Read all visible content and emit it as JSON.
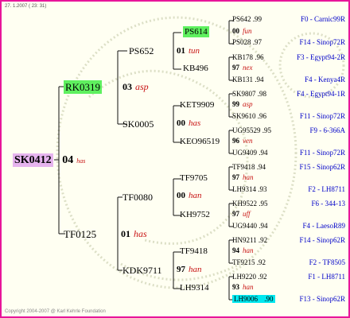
{
  "header": "27. 1.2007 ( 23: 31)",
  "footer": "Copyright 2004-2007 @ Karl Kehrle Foundation",
  "colors": {
    "frame": "#e8159a",
    "subject_highlight": "#e6b4ee",
    "green_highlight": "#5ff05f",
    "cyan_highlight": "#00e8f0",
    "nickname": "#c81414",
    "right_label": "#0000c8"
  },
  "subject": {
    "name": "SK0412",
    "year": "04",
    "nick": "has"
  },
  "gen1": [
    {
      "name": "RK0319",
      "year": "03",
      "nick": "asp"
    },
    {
      "name": "TF0125",
      "year": "01",
      "nick": "has"
    }
  ],
  "gen2": [
    {
      "name": "PS652",
      "year": "01",
      "nick": "tun"
    },
    {
      "name": "SK0005",
      "year": "00",
      "nick": "has"
    },
    {
      "name": "TF0080",
      "year": "00",
      "nick": "han"
    },
    {
      "name": "KDK9711",
      "year": "97",
      "nick": "han"
    }
  ],
  "gen3": [
    {
      "name": "PS614",
      "year": "00",
      "nick": "fun"
    },
    {
      "name": "KB496",
      "year": "97",
      "nick": "nex"
    },
    {
      "name": "KET9909",
      "year": "99",
      "nick": "asp"
    },
    {
      "name": "KEO96519",
      "year": "96",
      "nick": "ven"
    },
    {
      "name": "TF9705",
      "year": "97",
      "nick": "han"
    },
    {
      "name": "KH9752",
      "year": "97",
      "nick": "uff"
    },
    {
      "name": "TF9418",
      "year": "94",
      "nick": "han"
    },
    {
      "name": "LH9314",
      "year": "93",
      "nick": "han"
    }
  ],
  "gen4": [
    {
      "name": "PS642",
      "year": ".99",
      "right": "F0 - Carnic99R"
    },
    {
      "name": "PS028",
      "year": ".97",
      "right": "F14 - Sinop72R"
    },
    {
      "name": "KB178",
      "year": ".96",
      "right": "F3 - Egypt94-2R"
    },
    {
      "name": "KB131",
      "year": ".94",
      "right": "F4 - Kenya4R"
    },
    {
      "name": "SK9807",
      "year": ".98",
      "right": "F4 - Egypt94-1R"
    },
    {
      "name": "SK9610",
      "year": ".96",
      "right": "F11 - Sinop72R"
    },
    {
      "name": "UG95529",
      "year": ".95",
      "right": "F9 - 6-366A"
    },
    {
      "name": "UG9409",
      "year": ".94",
      "right": "F11 - Sinop72R"
    },
    {
      "name": "TF9418",
      "year": ".94",
      "right": "F15 - Sinop62R"
    },
    {
      "name": "LH9314",
      "year": ".93",
      "right": "F2 - LH8711"
    },
    {
      "name": "KH9522",
      "year": ".95",
      "right": "F6 - 344-13"
    },
    {
      "name": "UG9440",
      "year": ".94",
      "right": "F4 - LaesoR89"
    },
    {
      "name": "HN9211",
      "year": ".92",
      "right": "F14 - Sinop62R"
    },
    {
      "name": "TF9215",
      "year": ".92",
      "right": "F2 - TF8505"
    },
    {
      "name": "LH9220",
      "year": ".92",
      "right": "F1 - LH8711"
    },
    {
      "name": "LH9006",
      "year": ".90",
      "right": "F13 - Sinop62R"
    }
  ]
}
